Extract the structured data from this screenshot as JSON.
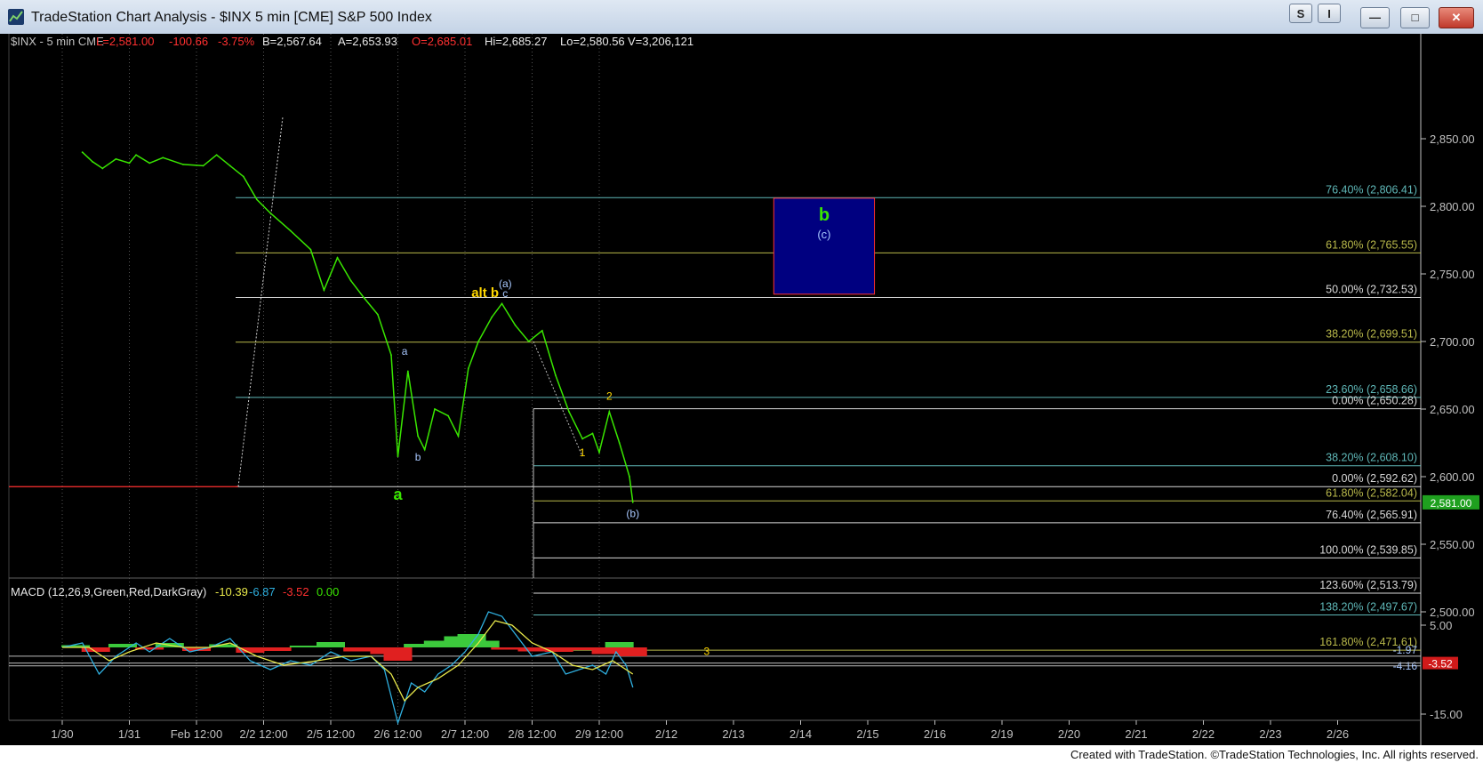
{
  "window": {
    "title": "TradeStation Chart Analysis - $INX 5 min [CME] S&P 500 Index",
    "btn_s": "S",
    "btn_i": "I",
    "btn_min": "—",
    "btn_max": "□",
    "btn_close": "✕"
  },
  "footer": "Created with TradeStation. ©TradeStation Technologies, Inc. All rights reserved.",
  "header": {
    "symbol": "$INX - 5 min  CME",
    "last": "L=2,581.00",
    "change": "-100.66",
    "pct": "-3.75%",
    "bid": "B=2,567.64",
    "ask": "A=2,653.93",
    "open": "O=2,685.01",
    "high": "Hi=2,685.27",
    "low": "Lo=2,580.56",
    "volume": "V=3,206,121"
  },
  "macd_header": {
    "name": "MACD (12,26,9,Green,Red,DarkGray)",
    "v1": "-10.39",
    "v2": "-6.87",
    "v3": "-3.52",
    "v4": "0.00"
  },
  "last_price_label": "2,581.00",
  "colors": {
    "price": "#39e600",
    "axis": "#c0c0c0",
    "teal": "#5fb8b8",
    "olive": "#b8b84a",
    "white": "#d8d8d8",
    "red": "#ff3030",
    "yellow": "#ffd700",
    "blue_label": "#a8c8ff",
    "box_fill": "#000080",
    "box_edge": "#ff3030",
    "macd_line": "#2fb0e0",
    "signal_line": "#e8e84a"
  },
  "chart_data": {
    "type": "line",
    "title": "$INX 5 min [CME] S&P 500 Index",
    "x_tick_labels": [
      "1/30",
      "1/31",
      "Feb 12:00",
      "2/2 12:00",
      "2/5 12:00",
      "2/6 12:00",
      "2/7 12:00",
      "2/8 12:00",
      "2/9 12:00",
      "2/12",
      "2/13",
      "2/14",
      "2/15",
      "2/16",
      "2/19",
      "2/20",
      "2/21",
      "2/22",
      "2/23",
      "2/26"
    ],
    "price_axis": {
      "ylim": [
        2450,
        2865
      ],
      "ticks": [
        2500,
        2550,
        2600,
        2650,
        2700,
        2750,
        2800,
        2850
      ],
      "tick_labels": [
        "2,500.00",
        "2,550.00",
        "2,600.00",
        "2,650.00",
        "2,700.00",
        "2,750.00",
        "2,800.00",
        "2,850.00"
      ]
    },
    "series": [
      {
        "values": [
          {
            "t": 0.3,
            "v": 2840
          },
          {
            "t": 0.45,
            "v": 2833
          },
          {
            "t": 0.6,
            "v": 2828
          },
          {
            "t": 0.8,
            "v": 2835
          },
          {
            "t": 1.0,
            "v": 2832
          },
          {
            "t": 1.1,
            "v": 2838
          },
          {
            "t": 1.3,
            "v": 2832
          },
          {
            "t": 1.5,
            "v": 2836
          },
          {
            "t": 1.8,
            "v": 2831
          },
          {
            "t": 2.1,
            "v": 2830
          },
          {
            "t": 2.3,
            "v": 2838
          },
          {
            "t": 2.5,
            "v": 2830
          },
          {
            "t": 2.7,
            "v": 2822
          },
          {
            "t": 2.9,
            "v": 2805
          },
          {
            "t": 3.1,
            "v": 2795
          },
          {
            "t": 3.4,
            "v": 2782
          },
          {
            "t": 3.7,
            "v": 2768
          },
          {
            "t": 3.9,
            "v": 2738
          },
          {
            "t": 4.1,
            "v": 2762
          },
          {
            "t": 4.3,
            "v": 2745
          },
          {
            "t": 4.5,
            "v": 2732
          },
          {
            "t": 4.7,
            "v": 2720
          },
          {
            "t": 4.9,
            "v": 2690
          },
          {
            "t": 5.0,
            "v": 2615
          },
          {
            "t": 5.15,
            "v": 2678
          },
          {
            "t": 5.3,
            "v": 2630
          },
          {
            "t": 5.4,
            "v": 2620
          },
          {
            "t": 5.55,
            "v": 2650
          },
          {
            "t": 5.75,
            "v": 2645
          },
          {
            "t": 5.9,
            "v": 2630
          },
          {
            "t": 6.05,
            "v": 2680
          },
          {
            "t": 6.2,
            "v": 2700
          },
          {
            "t": 6.4,
            "v": 2718
          },
          {
            "t": 6.55,
            "v": 2728
          },
          {
            "t": 6.75,
            "v": 2712
          },
          {
            "t": 6.95,
            "v": 2700
          },
          {
            "t": 7.15,
            "v": 2708
          },
          {
            "t": 7.35,
            "v": 2675
          },
          {
            "t": 7.55,
            "v": 2648
          },
          {
            "t": 7.75,
            "v": 2628
          },
          {
            "t": 7.9,
            "v": 2632
          },
          {
            "t": 8.0,
            "v": 2618
          },
          {
            "t": 8.15,
            "v": 2648
          },
          {
            "t": 8.3,
            "v": 2625
          },
          {
            "t": 8.45,
            "v": 2600
          },
          {
            "t": 8.5,
            "v": 2581
          }
        ]
      }
    ],
    "horizontal_levels": [
      {
        "label": "76.40% (2,806.41)",
        "value": 2806.41,
        "color": "teal"
      },
      {
        "label": "61.80% (2,765.55)",
        "value": 2765.55,
        "color": "olive"
      },
      {
        "label": "50.00% (2,732.53)",
        "value": 2732.53,
        "color": "white"
      },
      {
        "label": "38.20% (2,699.51)",
        "value": 2699.51,
        "color": "olive"
      },
      {
        "label": "23.60% (2,658.66)",
        "value": 2658.66,
        "color": "teal"
      },
      {
        "label": "0.00% (2,650.28)",
        "value": 2650.28,
        "color": "white"
      },
      {
        "label": "38.20% (2,608.10)",
        "value": 2608.1,
        "color": "teal"
      },
      {
        "label": "0.00% (2,592.62)",
        "value": 2592.62,
        "color": "white"
      },
      {
        "label": "61.80% (2,582.04)",
        "value": 2582.04,
        "color": "olive"
      },
      {
        "label": "76.40% (2,565.91)",
        "value": 2565.91,
        "color": "white"
      },
      {
        "label": "100.00% (2,539.85)",
        "value": 2539.85,
        "color": "white"
      },
      {
        "label": "123.60% (2,513.79)",
        "value": 2513.79,
        "color": "white"
      },
      {
        "label": "138.20% (2,497.67)",
        "value": 2497.67,
        "color": "teal"
      },
      {
        "label": "161.80% (2,471.61)",
        "value": 2471.61,
        "color": "olive"
      }
    ],
    "target_box": {
      "t_start": 10.6,
      "t_end": 12.1,
      "v_low": 2735,
      "v_high": 2806,
      "labels": [
        "b",
        "(c)"
      ]
    },
    "wave_labels": [
      {
        "text": "a",
        "t": 5.0,
        "v": 2583,
        "color": "green"
      },
      {
        "text": "a",
        "t": 5.1,
        "v": 2690,
        "color": "blue"
      },
      {
        "text": "b",
        "t": 5.3,
        "v": 2612,
        "color": "blue"
      },
      {
        "text": "alt b",
        "t": 6.3,
        "v": 2733,
        "color": "yellow"
      },
      {
        "text": "(a)",
        "t": 6.6,
        "v": 2740,
        "color": "blue"
      },
      {
        "text": "c",
        "t": 6.6,
        "v": 2733,
        "color": "blue"
      },
      {
        "text": "2",
        "t": 8.15,
        "v": 2657,
        "color": "yellow"
      },
      {
        "text": "1",
        "t": 7.75,
        "v": 2615,
        "color": "yellow"
      },
      {
        "text": "(b)",
        "t": 8.5,
        "v": 2570,
        "color": "blue"
      },
      {
        "text": "3",
        "t": 9.6,
        "v": 2468,
        "color": "yellow"
      }
    ],
    "macd": {
      "ylim": [
        -18,
        10
      ],
      "ticks": [
        5,
        -15
      ],
      "tick_labels": [
        "5.00",
        "-15.00"
      ],
      "markers": [
        {
          "label": "-1.97",
          "value": -1.97
        },
        {
          "label": "-4.16",
          "value": -4.16
        },
        {
          "label": "-3.52",
          "value": -3.52
        }
      ],
      "macd_line": [
        {
          "t": 0.0,
          "v": 0
        },
        {
          "t": 0.3,
          "v": 1
        },
        {
          "t": 0.55,
          "v": -6
        },
        {
          "t": 0.8,
          "v": -2
        },
        {
          "t": 1.1,
          "v": 1
        },
        {
          "t": 1.3,
          "v": -1
        },
        {
          "t": 1.6,
          "v": 2
        },
        {
          "t": 1.9,
          "v": -1
        },
        {
          "t": 2.2,
          "v": 0
        },
        {
          "t": 2.5,
          "v": 2
        },
        {
          "t": 2.8,
          "v": -3
        },
        {
          "t": 3.1,
          "v": -5
        },
        {
          "t": 3.4,
          "v": -3
        },
        {
          "t": 3.7,
          "v": -4
        },
        {
          "t": 4.0,
          "v": -1
        },
        {
          "t": 4.3,
          "v": -3
        },
        {
          "t": 4.6,
          "v": -2
        },
        {
          "t": 4.8,
          "v": -5
        },
        {
          "t": 5.0,
          "v": -17
        },
        {
          "t": 5.2,
          "v": -8
        },
        {
          "t": 5.4,
          "v": -10
        },
        {
          "t": 5.6,
          "v": -6
        },
        {
          "t": 5.8,
          "v": -4
        },
        {
          "t": 6.0,
          "v": -1
        },
        {
          "t": 6.2,
          "v": 3
        },
        {
          "t": 6.35,
          "v": 8
        },
        {
          "t": 6.55,
          "v": 7
        },
        {
          "t": 6.75,
          "v": 3
        },
        {
          "t": 7.0,
          "v": -2
        },
        {
          "t": 7.3,
          "v": -1
        },
        {
          "t": 7.5,
          "v": -6
        },
        {
          "t": 7.7,
          "v": -5
        },
        {
          "t": 7.9,
          "v": -4
        },
        {
          "t": 8.1,
          "v": -6
        },
        {
          "t": 8.25,
          "v": -1
        },
        {
          "t": 8.4,
          "v": -4
        },
        {
          "t": 8.5,
          "v": -9
        }
      ],
      "signal_line": [
        {
          "t": 0.0,
          "v": 0
        },
        {
          "t": 0.4,
          "v": 0
        },
        {
          "t": 0.7,
          "v": -3
        },
        {
          "t": 1.0,
          "v": -1
        },
        {
          "t": 1.4,
          "v": 1
        },
        {
          "t": 1.8,
          "v": 0
        },
        {
          "t": 2.2,
          "v": 0
        },
        {
          "t": 2.5,
          "v": 1
        },
        {
          "t": 2.9,
          "v": -2
        },
        {
          "t": 3.3,
          "v": -4
        },
        {
          "t": 3.8,
          "v": -3
        },
        {
          "t": 4.2,
          "v": -2
        },
        {
          "t": 4.6,
          "v": -2
        },
        {
          "t": 4.9,
          "v": -6
        },
        {
          "t": 5.1,
          "v": -12
        },
        {
          "t": 5.3,
          "v": -9
        },
        {
          "t": 5.6,
          "v": -7
        },
        {
          "t": 5.9,
          "v": -4
        },
        {
          "t": 6.2,
          "v": 1
        },
        {
          "t": 6.45,
          "v": 6
        },
        {
          "t": 6.7,
          "v": 5
        },
        {
          "t": 7.0,
          "v": 1
        },
        {
          "t": 7.3,
          "v": -1
        },
        {
          "t": 7.6,
          "v": -4
        },
        {
          "t": 7.9,
          "v": -5
        },
        {
          "t": 8.2,
          "v": -3
        },
        {
          "t": 8.5,
          "v": -6
        }
      ],
      "histogram": [
        {
          "t": 0.2,
          "v": 0.5
        },
        {
          "t": 0.5,
          "v": -1
        },
        {
          "t": 0.9,
          "v": 0.8
        },
        {
          "t": 1.3,
          "v": -0.5
        },
        {
          "t": 1.6,
          "v": 1
        },
        {
          "t": 2.0,
          "v": -0.8
        },
        {
          "t": 2.4,
          "v": 0.7
        },
        {
          "t": 2.8,
          "v": -1.2
        },
        {
          "t": 3.2,
          "v": -0.8
        },
        {
          "t": 3.6,
          "v": 0.4
        },
        {
          "t": 4.0,
          "v": 1.2
        },
        {
          "t": 4.4,
          "v": -0.9
        },
        {
          "t": 4.8,
          "v": -1.5
        },
        {
          "t": 5.0,
          "v": -3
        },
        {
          "t": 5.3,
          "v": 0.8
        },
        {
          "t": 5.6,
          "v": 1.5
        },
        {
          "t": 5.9,
          "v": 2.5
        },
        {
          "t": 6.1,
          "v": 3
        },
        {
          "t": 6.3,
          "v": 1.5
        },
        {
          "t": 6.6,
          "v": -0.5
        },
        {
          "t": 7.0,
          "v": -0.9
        },
        {
          "t": 7.4,
          "v": -1
        },
        {
          "t": 7.8,
          "v": -0.6
        },
        {
          "t": 8.1,
          "v": -1.5
        },
        {
          "t": 8.3,
          "v": 1.2
        },
        {
          "t": 8.5,
          "v": -2
        }
      ]
    }
  }
}
